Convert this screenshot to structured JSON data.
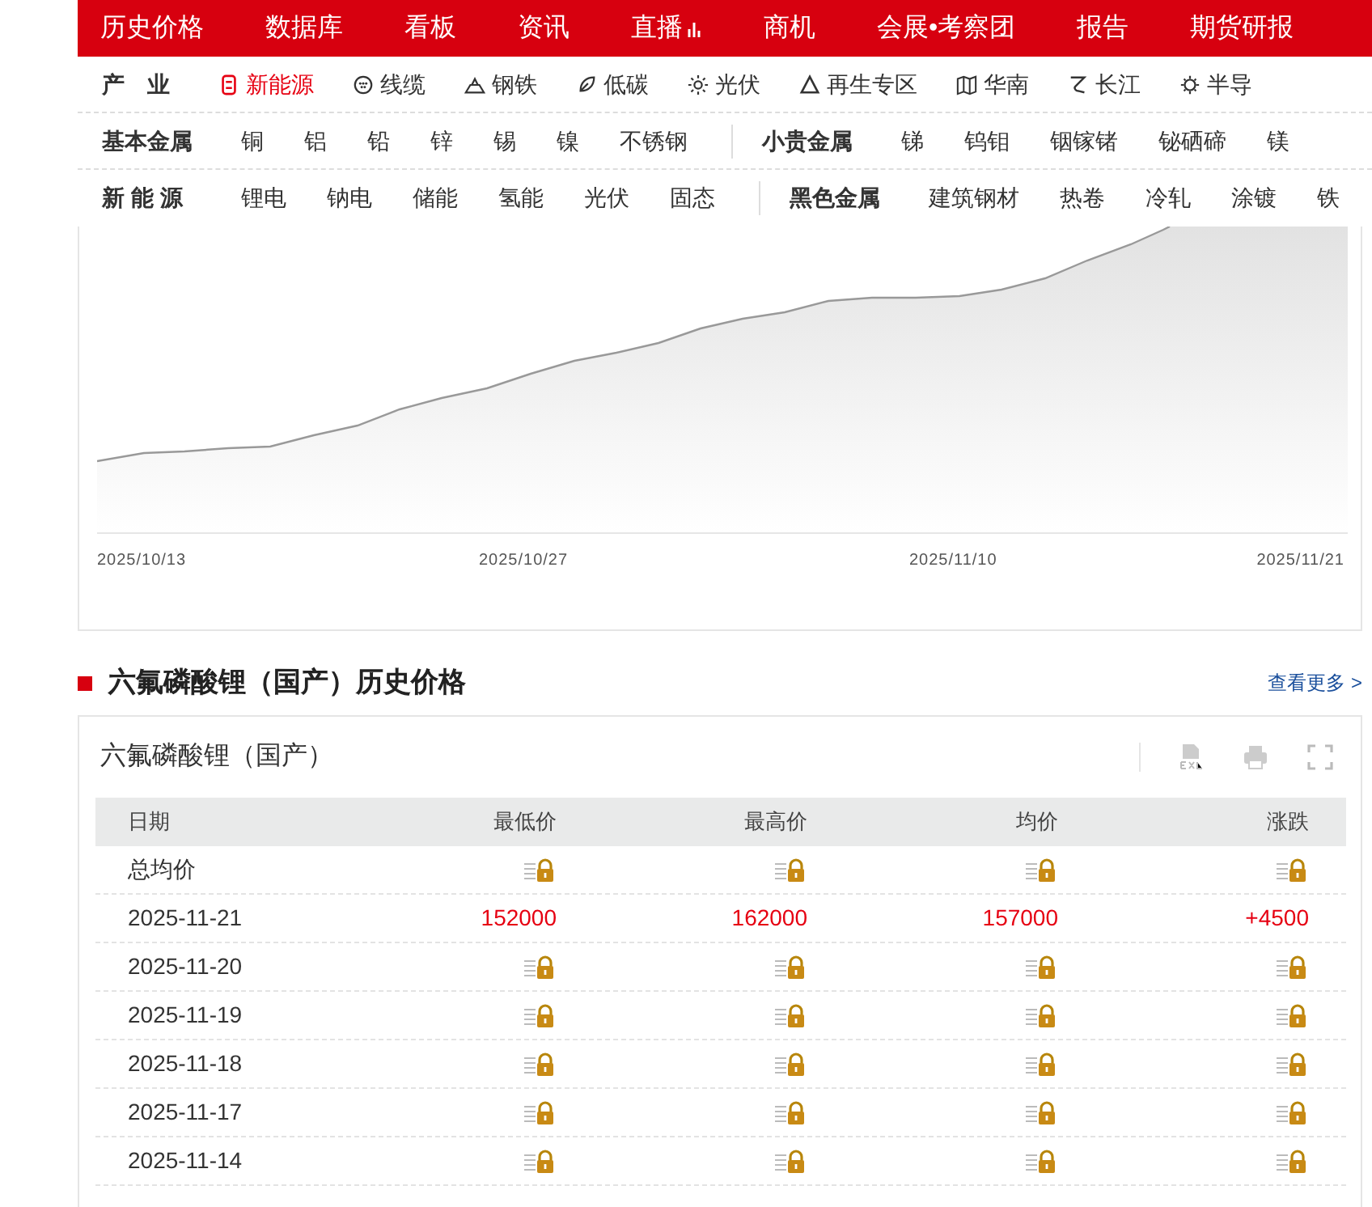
{
  "top_nav": [
    {
      "label": "历史价格",
      "kind": "text"
    },
    {
      "label": "数据库",
      "kind": "text"
    },
    {
      "label": "看板",
      "kind": "text"
    },
    {
      "label": "资讯",
      "kind": "text"
    },
    {
      "label": "直播",
      "kind": "live"
    },
    {
      "label": "商机",
      "kind": "text"
    },
    {
      "label": "会展•考察团",
      "kind": "text"
    },
    {
      "label": "报告",
      "kind": "text"
    },
    {
      "label": "期货研报",
      "kind": "text"
    }
  ],
  "industry_bar": {
    "label": "产　业",
    "items": [
      {
        "label": "新能源",
        "selected": true
      },
      {
        "label": "线缆",
        "selected": false
      },
      {
        "label": "钢铁",
        "selected": false
      },
      {
        "label": "低碳",
        "selected": false
      },
      {
        "label": "光伏",
        "selected": false
      },
      {
        "label": "再生专区",
        "selected": false
      },
      {
        "label": "华南",
        "selected": false
      },
      {
        "label": "长江",
        "selected": false
      },
      {
        "label": "半导",
        "selected": false
      }
    ]
  },
  "category_rows": [
    {
      "groups": [
        {
          "label": "基本金属",
          "items": [
            "铜",
            "铝",
            "铅",
            "锌",
            "锡",
            "镍",
            "不锈钢"
          ]
        },
        {
          "label": "小贵金属",
          "items": [
            "锑",
            "钨钼",
            "铟镓锗",
            "铋硒碲",
            "镁"
          ]
        }
      ]
    },
    {
      "groups": [
        {
          "label": "新 能 源",
          "items": [
            "锂电",
            "钠电",
            "储能",
            "氢能",
            "光伏",
            "固态"
          ]
        },
        {
          "label": "黑色金属",
          "items": [
            "建筑钢材",
            "热卷",
            "冷轧",
            "涂镀",
            "铁"
          ]
        }
      ]
    }
  ],
  "chart": {
    "x_labels": [
      "2025/10/13",
      "2025/10/27",
      "2025/11/10",
      "2025/11/21"
    ]
  },
  "section": {
    "title": "六氟磷酸锂（国产）历史价格",
    "more_link": "查看更多 >"
  },
  "table": {
    "title": "六氟磷酸锂（国产）",
    "columns": [
      "日期",
      "最低价",
      "最高价",
      "均价",
      "涨跌"
    ],
    "rows": [
      {
        "cells": [
          {
            "kind": "text",
            "text": "总均价"
          },
          {
            "kind": "lock"
          },
          {
            "kind": "lock"
          },
          {
            "kind": "lock"
          },
          {
            "kind": "lock"
          }
        ]
      },
      {
        "cells": [
          {
            "kind": "text",
            "text": "2025-11-21"
          },
          {
            "kind": "value",
            "text": "152000"
          },
          {
            "kind": "value",
            "text": "162000"
          },
          {
            "kind": "value",
            "text": "157000"
          },
          {
            "kind": "value",
            "text": "+4500"
          }
        ]
      },
      {
        "cells": [
          {
            "kind": "text",
            "text": "2025-11-20"
          },
          {
            "kind": "lock"
          },
          {
            "kind": "lock"
          },
          {
            "kind": "lock"
          },
          {
            "kind": "lock"
          }
        ]
      },
      {
        "cells": [
          {
            "kind": "text",
            "text": "2025-11-19"
          },
          {
            "kind": "lock"
          },
          {
            "kind": "lock"
          },
          {
            "kind": "lock"
          },
          {
            "kind": "lock"
          }
        ]
      },
      {
        "cells": [
          {
            "kind": "text",
            "text": "2025-11-18"
          },
          {
            "kind": "lock"
          },
          {
            "kind": "lock"
          },
          {
            "kind": "lock"
          },
          {
            "kind": "lock"
          }
        ]
      },
      {
        "cells": [
          {
            "kind": "text",
            "text": "2025-11-17"
          },
          {
            "kind": "lock"
          },
          {
            "kind": "lock"
          },
          {
            "kind": "lock"
          },
          {
            "kind": "lock"
          }
        ]
      },
      {
        "cells": [
          {
            "kind": "text",
            "text": "2025-11-14"
          },
          {
            "kind": "lock"
          },
          {
            "kind": "lock"
          },
          {
            "kind": "lock"
          },
          {
            "kind": "lock"
          }
        ]
      }
    ]
  }
}
